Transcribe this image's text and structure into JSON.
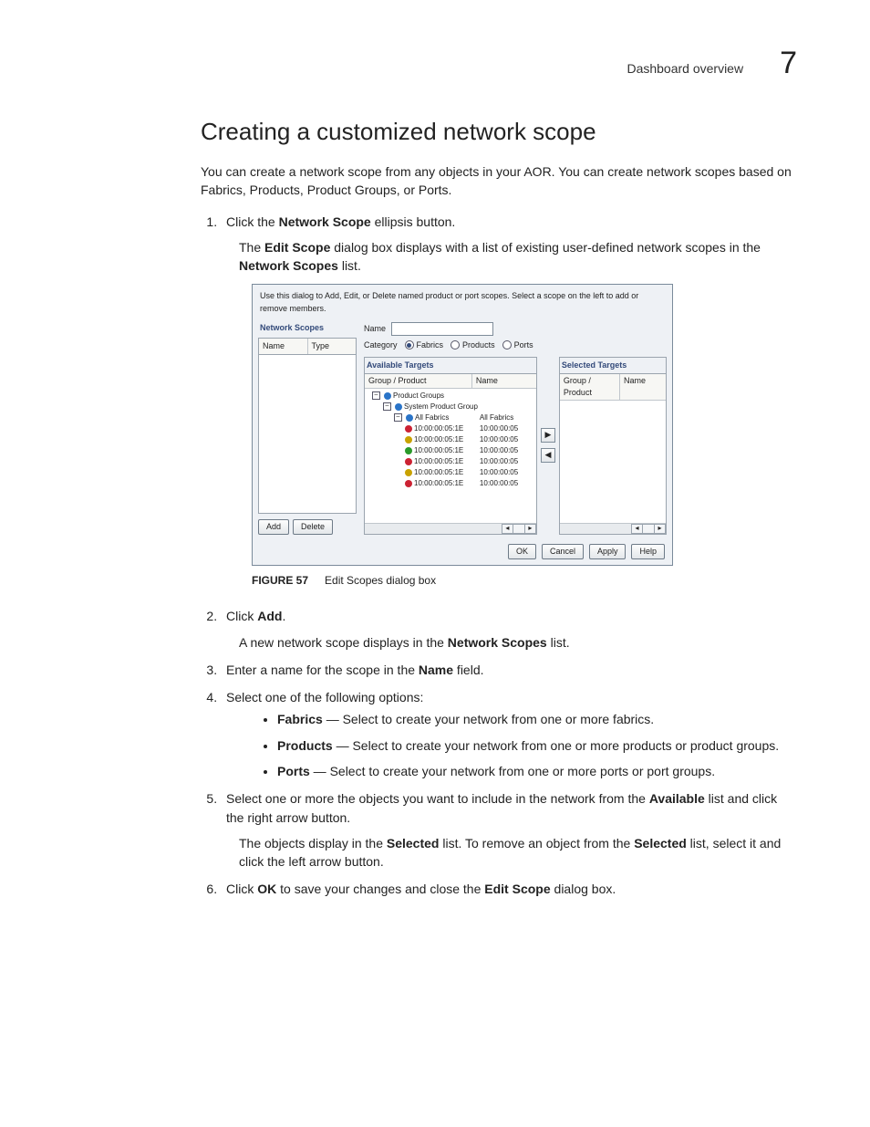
{
  "header": {
    "crumb": "Dashboard overview",
    "chapter": "7"
  },
  "title": "Creating a customized network scope",
  "intro": "You can create a network scope from any objects in your AOR. You can create network scopes based on Fabrics, Products, Product Groups, or Ports.",
  "step1_a": "Click the ",
  "step1_b": "Network Scope",
  "step1_c": " ellipsis button.",
  "step1_p_a": "The ",
  "step1_p_b": "Edit Scope",
  "step1_p_c": " dialog box displays with a list of existing user-defined network scopes in the ",
  "step1_p_d": "Network Scopes",
  "step1_p_e": " list.",
  "figure": {
    "label": "FIGURE 57",
    "caption": "Edit Scopes dialog box"
  },
  "dialog": {
    "instruction": "Use this dialog to Add, Edit, or Delete named product or port scopes. Select a scope on the left to add or remove members.",
    "scopes_title": "Network Scopes",
    "col_name": "Name",
    "col_type": "Type",
    "add": "Add",
    "delete": "Delete",
    "name_label": "Name",
    "category_label": "Category",
    "radios": {
      "fabrics": "Fabrics",
      "products": "Products",
      "ports": "Ports"
    },
    "available_title": "Available Targets",
    "selected_title": "Selected Targets",
    "col_group": "Group / Product",
    "tree": {
      "r1": "Product Groups",
      "r2": "System Product Group",
      "r3": "All Fabrics",
      "r3n": "All Fabrics",
      "wwn1": "10:00:00:05:1E",
      "wwn2": "10:00:00:05"
    },
    "ok": "OK",
    "cancel": "Cancel",
    "apply": "Apply",
    "help": "Help"
  },
  "step2_a": "Click ",
  "step2_b": "Add",
  "step2_c": ".",
  "step2_p_a": "A new network scope displays in the ",
  "step2_p_b": "Network Scopes",
  "step2_p_c": " list.",
  "step3_a": "Enter a name for the scope in the ",
  "step3_b": "Name",
  "step3_c": " field.",
  "step4": "Select one of the following options:",
  "opt_fabrics_a": "Fabrics",
  "opt_fabrics_b": " — Select to create your network from one or more fabrics.",
  "opt_products_a": "Products",
  "opt_products_b": " — Select to create your network from one or more products or product groups.",
  "opt_ports_a": "Ports",
  "opt_ports_b": " — Select to create your network from one or more ports or port groups.",
  "step5_a": "Select one or more the objects you want to include in the network from the ",
  "step5_b": "Available",
  "step5_c": " list and click the right arrow button.",
  "step5_p_a": "The objects display in the ",
  "step5_p_b": "Selected",
  "step5_p_c": " list. To remove an object from the ",
  "step5_p_d": "Selected",
  "step5_p_e": " list, select it and click the left arrow button.",
  "step6_a": "Click ",
  "step6_b": "OK",
  "step6_c": " to save your changes and close the ",
  "step6_d": "Edit Scope",
  "step6_e": " dialog box."
}
